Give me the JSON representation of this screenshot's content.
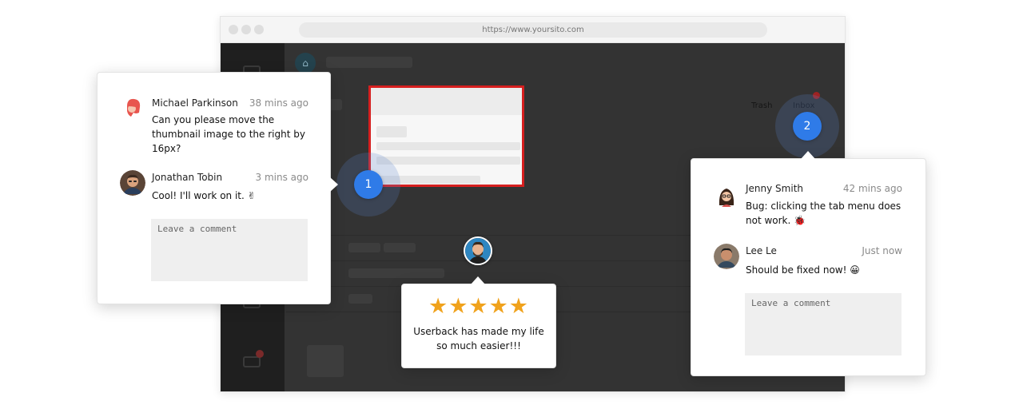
{
  "browser": {
    "url": "https://www.yoursito.com"
  },
  "app": {
    "tabs": [
      {
        "label": "Trash"
      },
      {
        "label": "Inbox"
      }
    ]
  },
  "markers": [
    {
      "number": "1"
    },
    {
      "number": "2"
    }
  ],
  "left_thread": {
    "comments": [
      {
        "author": "Michael Parkinson",
        "time": "38 mins ago",
        "text": "Can you please move the thumbnail image to the right by 16px?"
      },
      {
        "author": "Jonathan Tobin",
        "time": "3 mins ago",
        "text": "Cool! I'll work on it. ✌"
      }
    ],
    "input_placeholder": "Leave a comment"
  },
  "right_thread": {
    "comments": [
      {
        "author": "Jenny Smith",
        "time": "42 mins ago",
        "text": "Bug: clicking the tab menu does not work. 🐞"
      },
      {
        "author": "Lee Le",
        "time": "Just now",
        "text": "Should be fixed now! 😀"
      }
    ],
    "input_placeholder": "Leave a comment"
  },
  "review": {
    "rating": 5,
    "max_rating": 5,
    "stars": "★★★★★",
    "text": "Userback has made my life so much easier!!!"
  },
  "colors": {
    "marker": "#2f7be8",
    "highlight": "#d61f1f",
    "star": "#f0a21c",
    "app_background": "#333333"
  }
}
